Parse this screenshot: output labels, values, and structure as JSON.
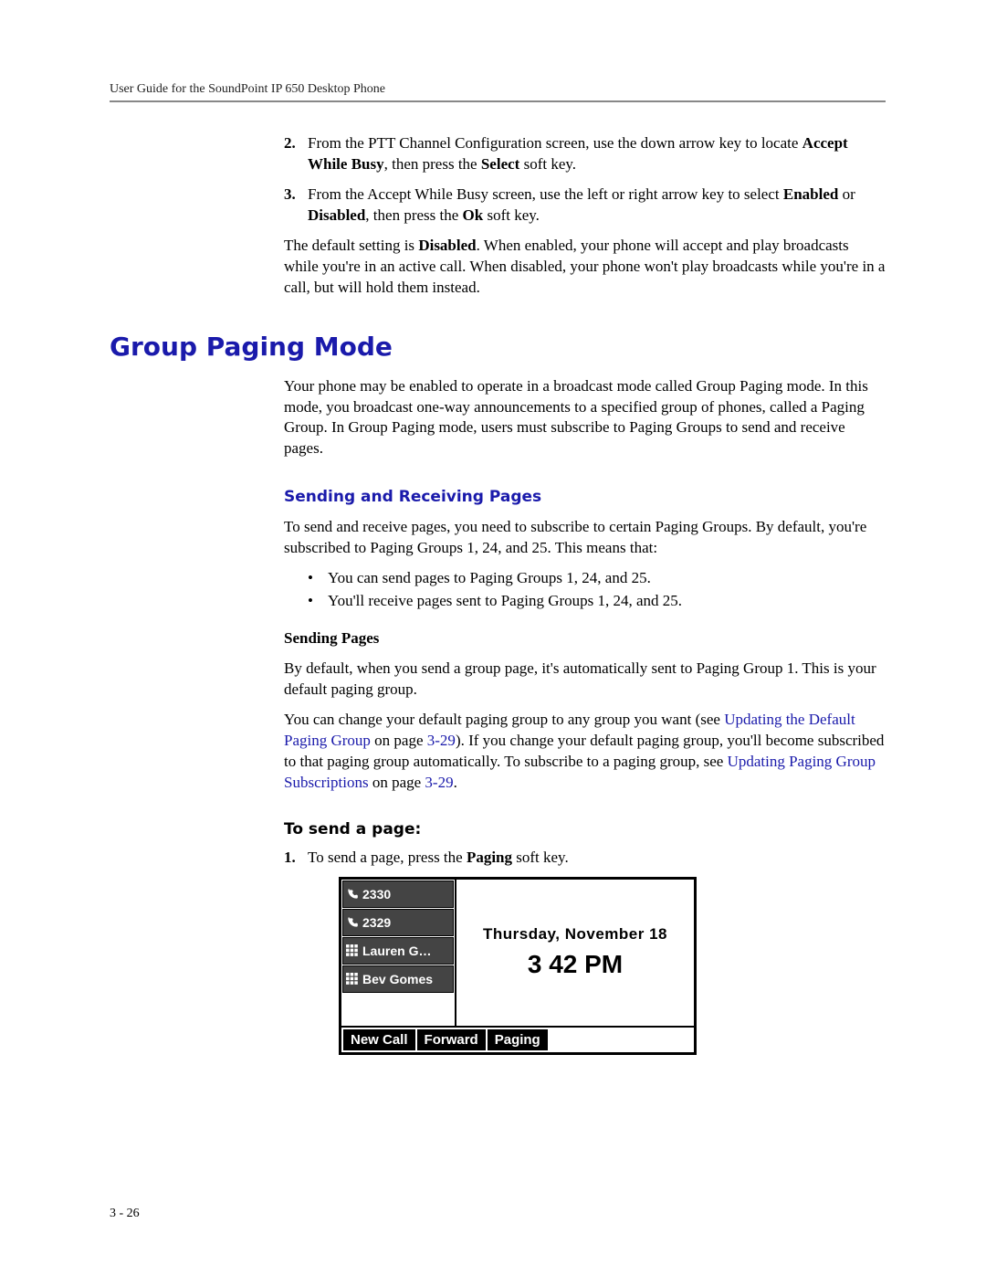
{
  "running_head": "User Guide for the SoundPoint IP 650 Desktop Phone",
  "steps_top": [
    "From the PTT Channel Configuration screen, use the down arrow key to locate <b>Accept While Busy</b>, then press the <b>Select</b> soft key.",
    "From the Accept While Busy screen, use the left or right arrow key to select <b>Enabled</b> or <b>Disabled</b>, then press the <b>Ok</b> soft key."
  ],
  "default_para": "The default setting is <b>Disabled</b>. When enabled, your phone will accept and play broadcasts while you're in an active call. When disabled, your phone won't play broadcasts while you're in a call, but will hold them instead.",
  "h1": "Group Paging Mode",
  "gpm_intro": "Your phone may be enabled to operate in a broadcast mode called Group Paging mode. In this mode, you broadcast one-way announcements to a specified group of phones, called a Paging Group. In Group Paging mode, users must subscribe to Paging Groups to send and receive pages.",
  "h2": "Sending and Receiving Pages",
  "srp_intro": "To send and receive pages, you need to subscribe to certain Paging Groups. By default, you're subscribed to Paging Groups 1, 24, and 25. This means that:",
  "bullets": [
    "You can send pages to Paging Groups 1, 24, and 25.",
    "You'll receive pages sent to Paging Groups 1, 24, and 25."
  ],
  "h3": "Sending Pages",
  "sp_para1": "By default, when you send a group page, it's automatically sent to Paging Group 1. This is your default paging group.",
  "sp_para2_pre": "You can change your default paging group to any group you want (see ",
  "link1_text": "Updating the Default Paging Group",
  "sp_para2_mid1": " on page ",
  "link1_page": "3-29",
  "sp_para2_mid2": "). If you change your default paging group, you'll become subscribed to that paging group automatically. To subscribe to a paging group, see ",
  "link2_text": "Updating Paging Group Subscriptions",
  "sp_para2_end1": " on page ",
  "link2_page": "3-29",
  "sp_para2_end2": ".",
  "h4": "To send a page:",
  "step1": "To send a page, press the <b>Paging</b> soft key.",
  "phone": {
    "lines": [
      "2330",
      "2329",
      "Lauren G…",
      "Bev Gomes"
    ],
    "date": "Thursday, November 18",
    "time": "3 42 PM",
    "softkeys": [
      "New Call",
      "Forward",
      "Paging"
    ]
  },
  "page_number": "3 - 26"
}
